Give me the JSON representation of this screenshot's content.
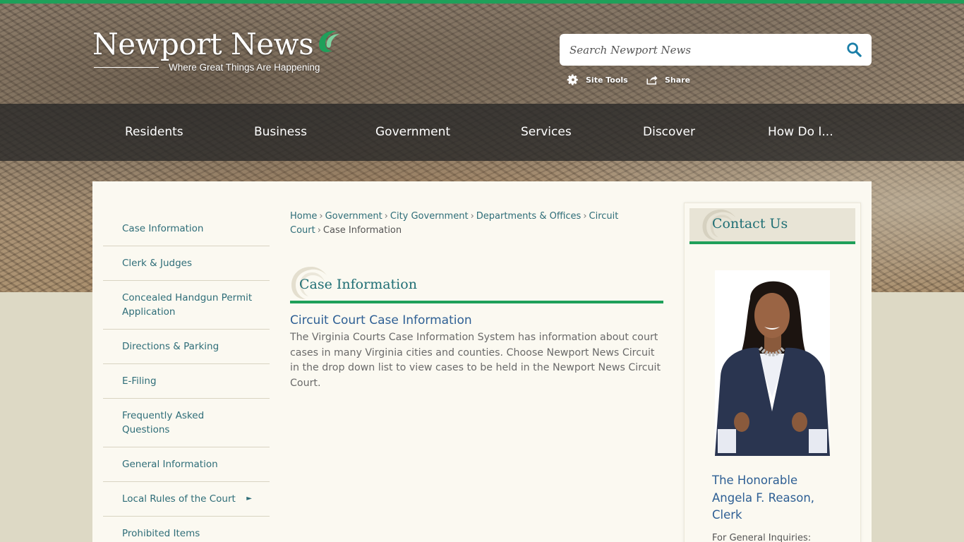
{
  "brand": {
    "logo_name": "Newport News",
    "tagline": "Where Great Things Are Happening"
  },
  "search": {
    "placeholder": "Search Newport News"
  },
  "tools": {
    "site_tools": "Site Tools",
    "share": "Share"
  },
  "nav": {
    "items": [
      "Residents",
      "Business",
      "Government",
      "Services",
      "Discover",
      "How Do I..."
    ]
  },
  "sidebar": {
    "items": [
      {
        "label": "Case Information"
      },
      {
        "label": "Clerk & Judges"
      },
      {
        "label": "Concealed Handgun Permit Application"
      },
      {
        "label": "Directions & Parking"
      },
      {
        "label": "E-Filing"
      },
      {
        "label": "Frequently Asked Questions"
      },
      {
        "label": "General Information"
      },
      {
        "label": "Local Rules of the Court",
        "arrow": "►"
      },
      {
        "label": "Prohibited Items"
      }
    ]
  },
  "breadcrumb": {
    "items": [
      "Home",
      "Government",
      "City Government",
      "Departments & Offices",
      "Circuit Court"
    ],
    "current": "Case Information"
  },
  "main": {
    "section_title": "Case Information",
    "article_title": "Circuit Court Case Information",
    "article_body": "The Virginia Courts Case Information System has information about court cases in many Virginia cities and counties. Choose Newport News Circuit in the drop down list to view cases to be held in the Newport News Circuit Court."
  },
  "contact": {
    "title": "Contact Us",
    "name": "The Honorable Angela F. Reason, Clerk",
    "inquiries": "For General Inquiries:"
  },
  "colors": {
    "accent_green": "#1fa05a",
    "link_teal": "#2e6d78",
    "link_blue": "#2e5f94",
    "panel_bg": "#fbf9f1",
    "page_bg": "#ddd9c5"
  }
}
